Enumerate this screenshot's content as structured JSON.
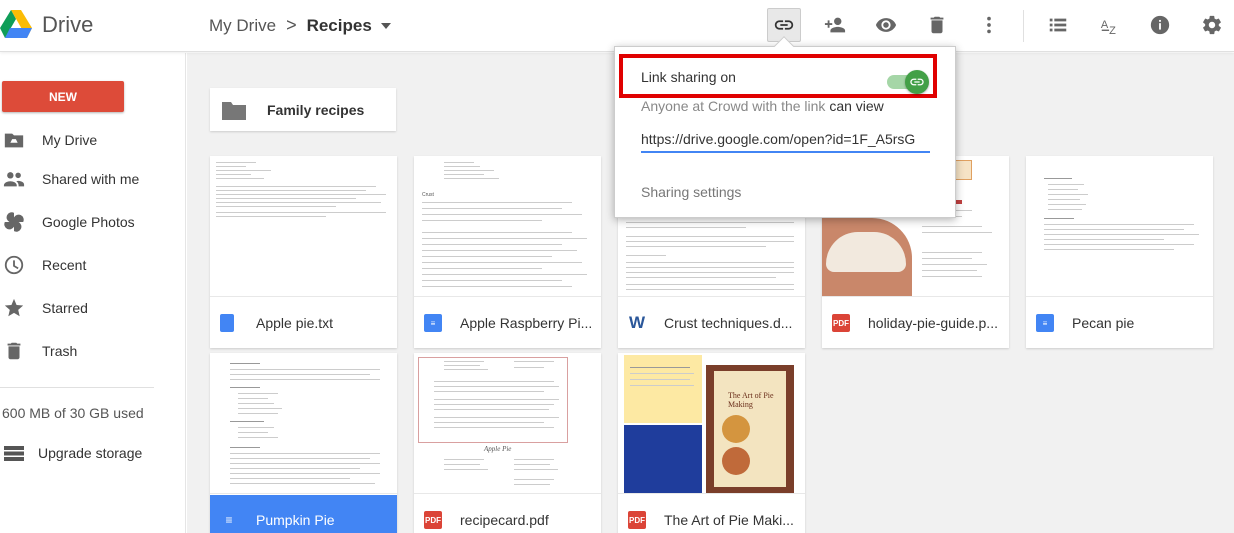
{
  "header": {
    "brand": "Drive",
    "breadcrumb": {
      "root": "My Drive",
      "separator": ">",
      "current": "Recipes"
    },
    "toolbar": [
      "link-icon",
      "add-person-icon",
      "eye-icon",
      "trash-icon",
      "more-vert-icon",
      "list-view-icon",
      "sort-az-icon",
      "info-icon",
      "settings-icon"
    ]
  },
  "sidebar": {
    "new_label": "NEW",
    "items": [
      {
        "label": "My Drive",
        "icon": "drive-folder-icon"
      },
      {
        "label": "Shared with me",
        "icon": "people-icon"
      },
      {
        "label": "Google Photos",
        "icon": "photos-icon"
      },
      {
        "label": "Recent",
        "icon": "clock-icon"
      },
      {
        "label": "Starred",
        "icon": "star-icon"
      },
      {
        "label": "Trash",
        "icon": "trash-icon"
      }
    ],
    "storage": "600 MB of 30 GB used",
    "upgrade": "Upgrade storage"
  },
  "main": {
    "folder": {
      "label": "Family recipes"
    },
    "files": [
      {
        "name": "Apple pie.txt",
        "type": "txt"
      },
      {
        "name": "Apple Raspberry Pi...",
        "type": "gdoc"
      },
      {
        "name": "Crust techniques.d...",
        "type": "word"
      },
      {
        "name": "holiday-pie-guide.p...",
        "type": "pdf"
      },
      {
        "name": "Pecan pie",
        "type": "gdoc"
      },
      {
        "name": "Pumpkin Pie",
        "type": "gdoc",
        "selected": true
      },
      {
        "name": "recipecard.pdf",
        "type": "pdf"
      },
      {
        "name": "The Art of Pie Maki...",
        "type": "pdf"
      }
    ],
    "thumb_text": {
      "apple_raspberry": "Crust",
      "recipecard": "Apple Pie",
      "art_title": "The Art of Pie Making"
    }
  },
  "share_popup": {
    "status": "Link sharing on",
    "who_prefix": "Anyone at Crowd with the link",
    "who_perm": "can view",
    "link": "https://drive.google.com/open?id=1F_A5rsG",
    "settings": "Sharing settings"
  },
  "colors": {
    "new_button": "#dd4b39",
    "selected": "#4285f4",
    "highlight": "#e00000",
    "toggle": "#43a047",
    "pdf": "#db4437",
    "gdoc": "#4285f4"
  }
}
